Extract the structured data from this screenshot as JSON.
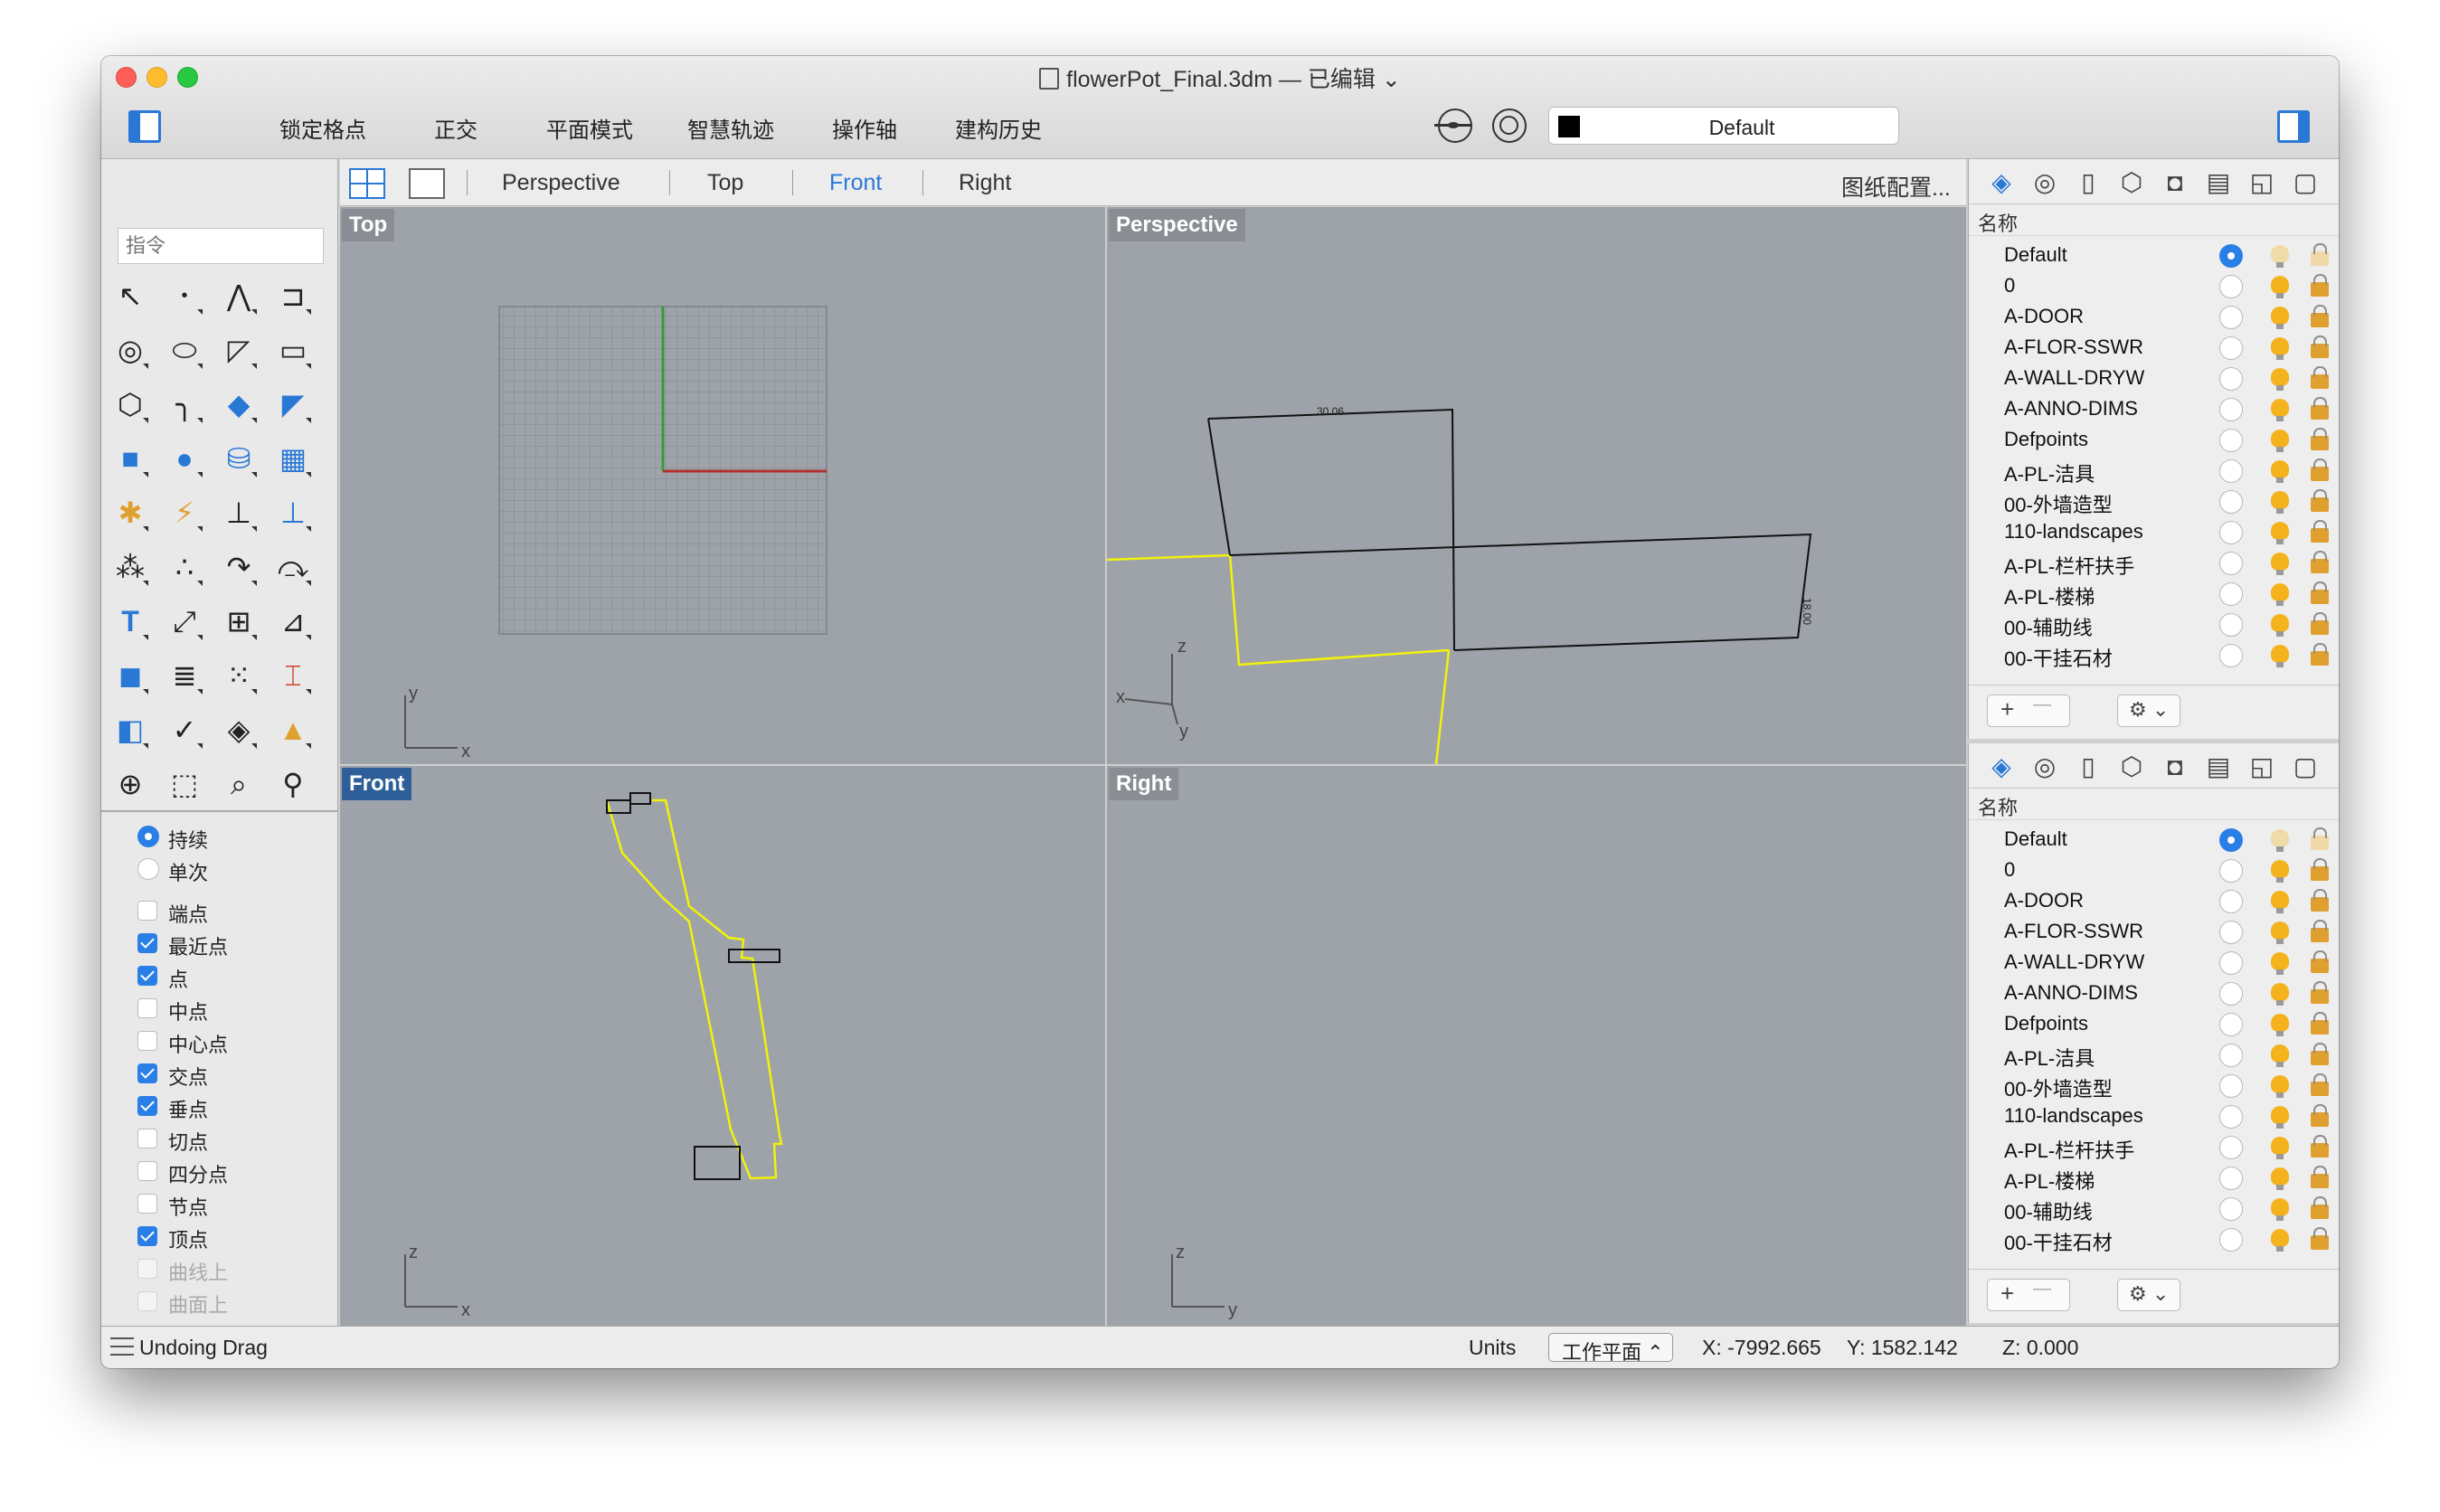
{
  "window": {
    "title": "flowerPot_Final.3dm — 已编辑",
    "title_chevron": "⌄",
    "traffic_lights": {
      "close": "#fe5f57",
      "minimize": "#febc2e",
      "zoom": "#28c840"
    }
  },
  "toolbar": {
    "buttons": [
      "锁定格点",
      "正交",
      "平面模式",
      "智慧轨迹",
      "操作轴",
      "建构历史"
    ],
    "current_layer": "Default",
    "current_layer_color": "#000000",
    "accent": "#2a78d6"
  },
  "command": {
    "placeholder": "指令"
  },
  "viewport_tabs": {
    "tabs": [
      "Perspective",
      "Top",
      "Front",
      "Right"
    ],
    "active": "Front",
    "layout_label": "图纸配置..."
  },
  "viewports": {
    "top": {
      "label": "Top",
      "axis_a": "y",
      "axis_b": "x"
    },
    "perspective": {
      "label": "Perspective",
      "axis_a": "z",
      "axis_b": "x",
      "axis_c": "y",
      "dim_label_1": "30.06",
      "dim_label_2": "18.00"
    },
    "front": {
      "label": "Front",
      "axis_a": "z",
      "axis_b": "x"
    },
    "right": {
      "label": "Right",
      "axis_a": "z",
      "axis_b": "y"
    }
  },
  "osnap": {
    "mode": [
      {
        "label": "持续",
        "on": true
      },
      {
        "label": "单次",
        "on": false
      }
    ],
    "items": [
      {
        "label": "端点",
        "on": false,
        "enabled": true
      },
      {
        "label": "最近点",
        "on": true,
        "enabled": true
      },
      {
        "label": "点",
        "on": true,
        "enabled": true
      },
      {
        "label": "中点",
        "on": false,
        "enabled": true
      },
      {
        "label": "中心点",
        "on": false,
        "enabled": true
      },
      {
        "label": "交点",
        "on": true,
        "enabled": true
      },
      {
        "label": "垂点",
        "on": true,
        "enabled": true
      },
      {
        "label": "切点",
        "on": false,
        "enabled": true
      },
      {
        "label": "四分点",
        "on": false,
        "enabled": true
      },
      {
        "label": "节点",
        "on": false,
        "enabled": true
      },
      {
        "label": "顶点",
        "on": true,
        "enabled": true
      },
      {
        "label": "曲线上",
        "on": false,
        "enabled": false
      },
      {
        "label": "曲面上",
        "on": false,
        "enabled": false
      }
    ]
  },
  "layers": {
    "column_name": "名称",
    "rows": [
      {
        "name": "Default",
        "current": true,
        "color": "#000000"
      },
      {
        "name": "0",
        "current": false,
        "color": "#000000"
      },
      {
        "name": "A-DOOR",
        "current": false,
        "color": "#00e000"
      },
      {
        "name": "A-FLOR-SSWR",
        "current": false,
        "color": "#00e8ff"
      },
      {
        "name": "A-WALL-DRYW",
        "current": false,
        "color": "#ff30ff"
      },
      {
        "name": "A-ANNO-DIMS",
        "current": false,
        "color": "#ff30ff"
      },
      {
        "name": "Defpoints",
        "current": false,
        "color": "#000000"
      },
      {
        "name": "A-PL-洁具",
        "current": false,
        "color": "#f6cd90"
      },
      {
        "name": "00-外墙造型",
        "current": false,
        "color": "#5a6fa8"
      },
      {
        "name": "110-landscapes",
        "current": false,
        "color": "#00e000"
      },
      {
        "name": "A-PL-栏杆扶手",
        "current": false,
        "color": "#a8d000"
      },
      {
        "name": "A-PL-楼梯",
        "current": false,
        "color": "#008c8c"
      },
      {
        "name": "00-辅助线",
        "current": false,
        "color": "#008c8c"
      },
      {
        "name": "00-干挂石材",
        "current": false,
        "color": "#70bcd0"
      }
    ],
    "add_label": "+",
    "remove_label": "—",
    "gear_label": "⚙ ⌄"
  },
  "status": {
    "message": "Undoing Drag",
    "units": "Units",
    "cplane": "工作平面 ⌃",
    "x": "X: -7992.665",
    "y": "Y: 1582.142",
    "z": "Z: 0.000"
  }
}
